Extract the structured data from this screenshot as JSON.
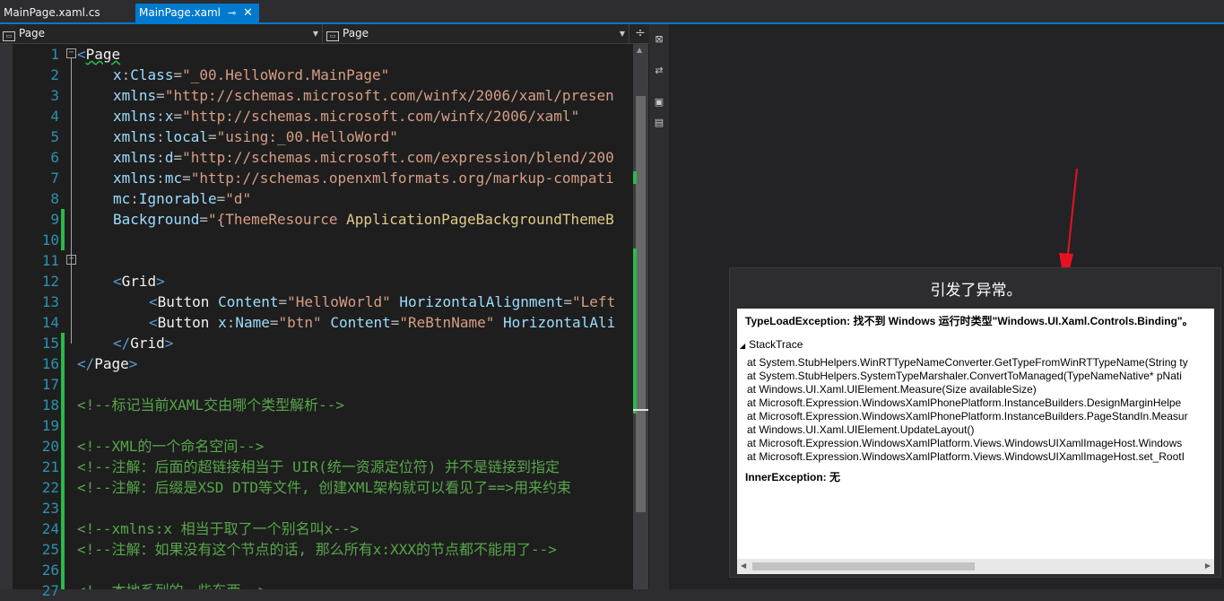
{
  "tabs": [
    {
      "label": "MainPage.xaml.cs",
      "active": false
    },
    {
      "label": "MainPage.xaml",
      "active": true,
      "pin_glyph": "⊸",
      "close_glyph": "✕"
    }
  ],
  "nav": {
    "left_value": "Page",
    "right_value": "Page",
    "split_glyph": "÷"
  },
  "line_numbers": [
    "1",
    "2",
    "3",
    "4",
    "5",
    "6",
    "7",
    "8",
    "9",
    "10",
    "11",
    "12",
    "13",
    "14",
    "15",
    "16",
    "17",
    "18",
    "19",
    "20",
    "21",
    "22",
    "23",
    "24",
    "25",
    "26",
    "27"
  ],
  "code": {
    "l1_open": "<",
    "l1_tag": "Page",
    "l2_ns": "x",
    "l2_colon": ":",
    "l2_attr": "Class",
    "l2_eq": "=",
    "l2_val": "\"_00.HelloWord.MainPage\"",
    "l3_attr": "xmlns",
    "l3_eq": "=",
    "l3_val": "\"http://schemas.microsoft.com/winfx/2006/xaml/presen",
    "l4_attr": "xmlns",
    "l4_colon": ":",
    "l4_attr2": "x",
    "l4_eq": "=",
    "l4_val": "\"http://schemas.microsoft.com/winfx/2006/xaml\"",
    "l5_attr": "xmlns",
    "l5_colon": ":",
    "l5_attr2": "local",
    "l5_eq": "=",
    "l5_val": "\"using:_00.HelloWord\"",
    "l6_attr": "xmlns",
    "l6_colon": ":",
    "l6_attr2": "d",
    "l6_eq": "=",
    "l6_val": "\"http://schemas.microsoft.com/expression/blend/200",
    "l7_attr": "xmlns",
    "l7_colon": ":",
    "l7_attr2": "mc",
    "l7_eq": "=",
    "l7_val": "\"http://schemas.openxmlformats.org/markup-compati",
    "l8_attr": "mc",
    "l8_colon": ":",
    "l8_attr2": "Ignorable",
    "l8_eq": "=",
    "l8_val": "\"d\"",
    "l9_attr": "Background",
    "l9_eq": "=",
    "l9_q": "\"{",
    "l9_ext": "ThemeResource",
    "l9_arg": " ApplicationPageBackgroundThemeB",
    "l11_open": "<",
    "l11_tag": "Grid",
    "l11_close": ">",
    "l12_open": "<",
    "l12_tag": "Button",
    "l12_a1": " Content",
    "l12_eq1": "=",
    "l12_v1": "\"HelloWorld\"",
    "l12_a2": " HorizontalAlignment",
    "l12_eq2": "=",
    "l12_v2": "\"Left",
    "l13_open": "<",
    "l13_tag": "Button",
    "l13_ns": " x",
    "l13_colon": ":",
    "l13_a1": "Name",
    "l13_eq1": "=",
    "l13_v1": "\"btn\"",
    "l13_a2": " Content",
    "l13_eq2": "=",
    "l13_v2": "\"ReBtnName\"",
    "l13_a3": " HorizontalAli",
    "l14_open": "</",
    "l14_tag": "Grid",
    "l14_close": ">",
    "l15_open": "</",
    "l15_tag": "Page",
    "l15_close": ">",
    "l17": "<!--标记当前XAML交由哪个类型解析-->",
    "l19": "<!--XML的一个命名空间-->",
    "l20": "<!--注解：后面的超链接相当于 UIR(统一资源定位符) 并不是链接到指定",
    "l21": "<!--注解：后缀是XSD DTD等文件, 创建XML架构就可以看见了==>用来约束",
    "l23": "<!--xmlns:x 相当于取了一个别名叫x-->",
    "l24": "<!--注解：如果没有这个节点的话, 那么所有x:XXX的节点都不能用了-->",
    "l26": "<!--本地系列的一些东西-->"
  },
  "side_toolbar": [
    "⊠",
    "⇄",
    "▣",
    "▤"
  ],
  "error": {
    "title": "引发了异常。",
    "exception": "TypeLoadException: 找不到 Windows 运行时类型\"Windows.UI.Xaml.Controls.Binding\"。",
    "stacktrace_label": "StackTrace",
    "frames": [
      "at System.StubHelpers.WinRTTypeNameConverter.GetTypeFromWinRTTypeName(String ty",
      "at System.StubHelpers.SystemTypeMarshaler.ConvertToManaged(TypeNameNative* pNati",
      "at Windows.UI.Xaml.UIElement.Measure(Size availableSize)",
      "at Microsoft.Expression.WindowsXamlPhonePlatform.InstanceBuilders.DesignMarginHelpe",
      "at Microsoft.Expression.WindowsXamlPhonePlatform.InstanceBuilders.PageStandIn.Measur",
      "at Windows.UI.Xaml.UIElement.UpdateLayout()",
      "at Microsoft.Expression.WindowsXamlPlatform.Views.WindowsUIXamlImageHost.Windows",
      "at Microsoft.Expression.WindowsXamlPlatform.Views.WindowsUIXamlImageHost.set_RootI"
    ],
    "inner_exception": "InnerException:  无"
  },
  "colors": {
    "accent": "#007acc",
    "change_bar": "#2db84b",
    "arrow": "#e81123"
  }
}
